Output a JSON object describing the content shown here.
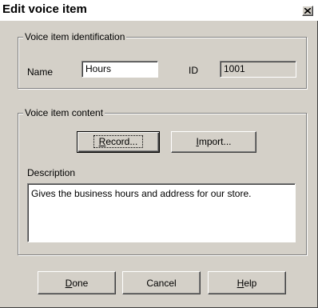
{
  "window": {
    "title": "Edit voice item"
  },
  "identification": {
    "caption": "Voice item identification",
    "name_label": "Name",
    "name_value": "Hours",
    "id_label": "ID",
    "id_value": "1001"
  },
  "content": {
    "caption": "Voice item content",
    "record_button": {
      "mnemonic": "R",
      "rest": "ecord..."
    },
    "import_button": {
      "mnemonic": "I",
      "rest": "mport..."
    },
    "description_label": "Description",
    "description_value": "Gives the business hours and address for our store."
  },
  "footer": {
    "done_button": {
      "mnemonic": "D",
      "rest": "one"
    },
    "cancel_button": "Cancel",
    "help_button": {
      "mnemonic": "H",
      "rest": "elp"
    }
  },
  "icons": {
    "close": "close-icon"
  },
  "colors": {
    "face": "#d4d0c8",
    "title_bg": "#ffffff"
  }
}
